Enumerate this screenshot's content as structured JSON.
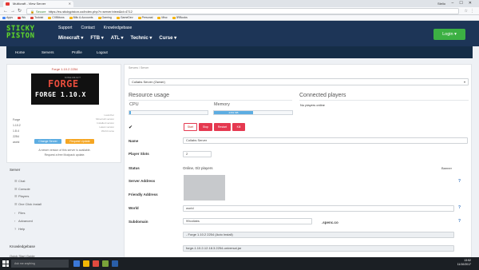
{
  "browser": {
    "tab_title": "Multicraft - View Server",
    "user_name": "Stelio",
    "url_secure_label": "Secure",
    "url": "https://eu.stickypiston.co/index.php?r=server/view&id=4712",
    "bookmarks": [
      {
        "label": "Apps",
        "color": "#4285f4"
      },
      {
        "label": "Wu",
        "color": "#e53935"
      },
      {
        "label": "Todoist",
        "color": "#db4035"
      },
      {
        "label": "CXBlitons",
        "color": "#f6b300"
      },
      {
        "label": "Bills & Accounts",
        "color": "#f6b300"
      },
      {
        "label": "Gaming",
        "color": "#f6b300"
      },
      {
        "label": "GameDev",
        "color": "#f6b300"
      },
      {
        "label": "Personal",
        "color": "#f6b300"
      },
      {
        "label": "Misc",
        "color": "#f6b300"
      },
      {
        "label": "3RBooks",
        "color": "#f6b300"
      }
    ]
  },
  "site": {
    "logo_line1": "STICKY",
    "logo_line2": "PISTON",
    "top_links": [
      "Support",
      "Contact",
      "Knowledgebase"
    ],
    "main_links": [
      "Minecraft ▾",
      "FTB ▾",
      "ATL ▾",
      "Technic ▾",
      "Curse ▾"
    ],
    "login_label": "Login ▾"
  },
  "subnav": [
    "Home",
    "Servers",
    "Profile",
    "Logout"
  ],
  "left": {
    "server_title": "Forge 1.10.2 2254",
    "banner_small": "MINECRAFT",
    "banner_big": "FORGE",
    "banner_version": "FORGE 1.10.X",
    "info_values": [
      "Forge",
      "1.10.2",
      "1.8.4",
      "2254",
      "world"
    ],
    "info_labels": [
      "Launcher",
      "Minecraft version",
      "Installed version",
      "Latest version",
      "World name"
    ],
    "change_server_label": "Change Server",
    "request_update_label": "Request Update",
    "note1": "A newer version of this server is available.",
    "note2": "Request a free Modpack update.",
    "server_heading": "Server",
    "server_items": [
      {
        "icon": "☰",
        "label": "Chat"
      },
      {
        "icon": "☰",
        "label": "Console"
      },
      {
        "icon": "☰",
        "label": "Players"
      },
      {
        "icon": "☰",
        "label": "One Click Install"
      },
      {
        "icon": "›",
        "label": "Files"
      },
      {
        "icon": "›",
        "label": "Advanced"
      },
      {
        "icon": "?",
        "label": "Help"
      }
    ],
    "kb_heading": "Knowledgebase",
    "kb_item": "Quick Start Guide"
  },
  "main": {
    "breadcrumb": "Servers / Server",
    "server_select": "Collabs Server (Owner)",
    "resource_usage_title": "Resource usage",
    "connected_players_title": "Connected players",
    "cpu_label": "CPU",
    "memory_label": "Memory",
    "cpu_fraction": 0.02,
    "memory_fraction": 0.5,
    "memory_text": "2363 MB",
    "no_players": "No players online",
    "buttons": [
      "Start",
      "Stop",
      "Restart",
      "Kill"
    ],
    "rows": {
      "name_label": "Name",
      "name_value": "Collabs Server",
      "slots_label": "Player Slots",
      "slots_value": "2",
      "status_label": "Status",
      "status_value": "Online, 0/2 players",
      "banner_link": "Banner",
      "address_label": "Server Address",
      "friendly_label": "Friendly Address",
      "world_label": "World",
      "world_value": "world",
      "subdomain_label": "Subdomain",
      "subdomain_value": "99collabs",
      "subdomain_suffix": ".spenc.co",
      "jar_select": "- Forge 1.10.2 2254 (Auto Install)",
      "jar_file": "forge-1.10.2-12.18.3.2254-universal.jar"
    }
  },
  "taskbar": {
    "search_placeholder": "Ask me anything",
    "time": "13:52",
    "date": "11/10/2017"
  }
}
